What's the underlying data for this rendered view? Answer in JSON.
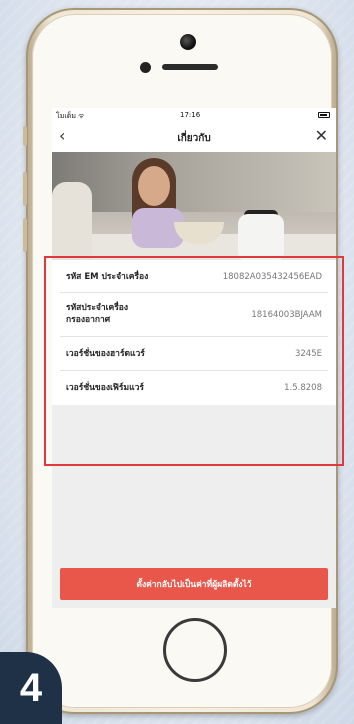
{
  "status_bar": {
    "carrier": "โมเด็ม ᯤ",
    "time": "17:16"
  },
  "nav": {
    "back_icon": "‹",
    "title": "เกี่ยวกับ",
    "close_icon": "✕"
  },
  "info": {
    "rows": [
      {
        "label": "รหัส EM ประจำเครื่อง",
        "value": "18082A035432456EAD"
      },
      {
        "label_line1": "รหัสประจำเครื่อง",
        "label_line2": "กรองอากาศ",
        "value": "18164003BJAAM"
      },
      {
        "label": "เวอร์ชั่นของฮาร์ดแวร์",
        "value": "3245E"
      },
      {
        "label": "เวอร์ชั่นของเฟิร์มแวร์",
        "value": "1.5.8208"
      }
    ]
  },
  "reset_button": {
    "label": "ตั้งค่ากลับไปเป็นค่าที่ผู้ผลิตตั้งไว้"
  },
  "step_badge": {
    "number": "4"
  },
  "colors": {
    "highlight": "#e0383c",
    "reset_button": "#e8574a",
    "badge": "#1e3146"
  }
}
